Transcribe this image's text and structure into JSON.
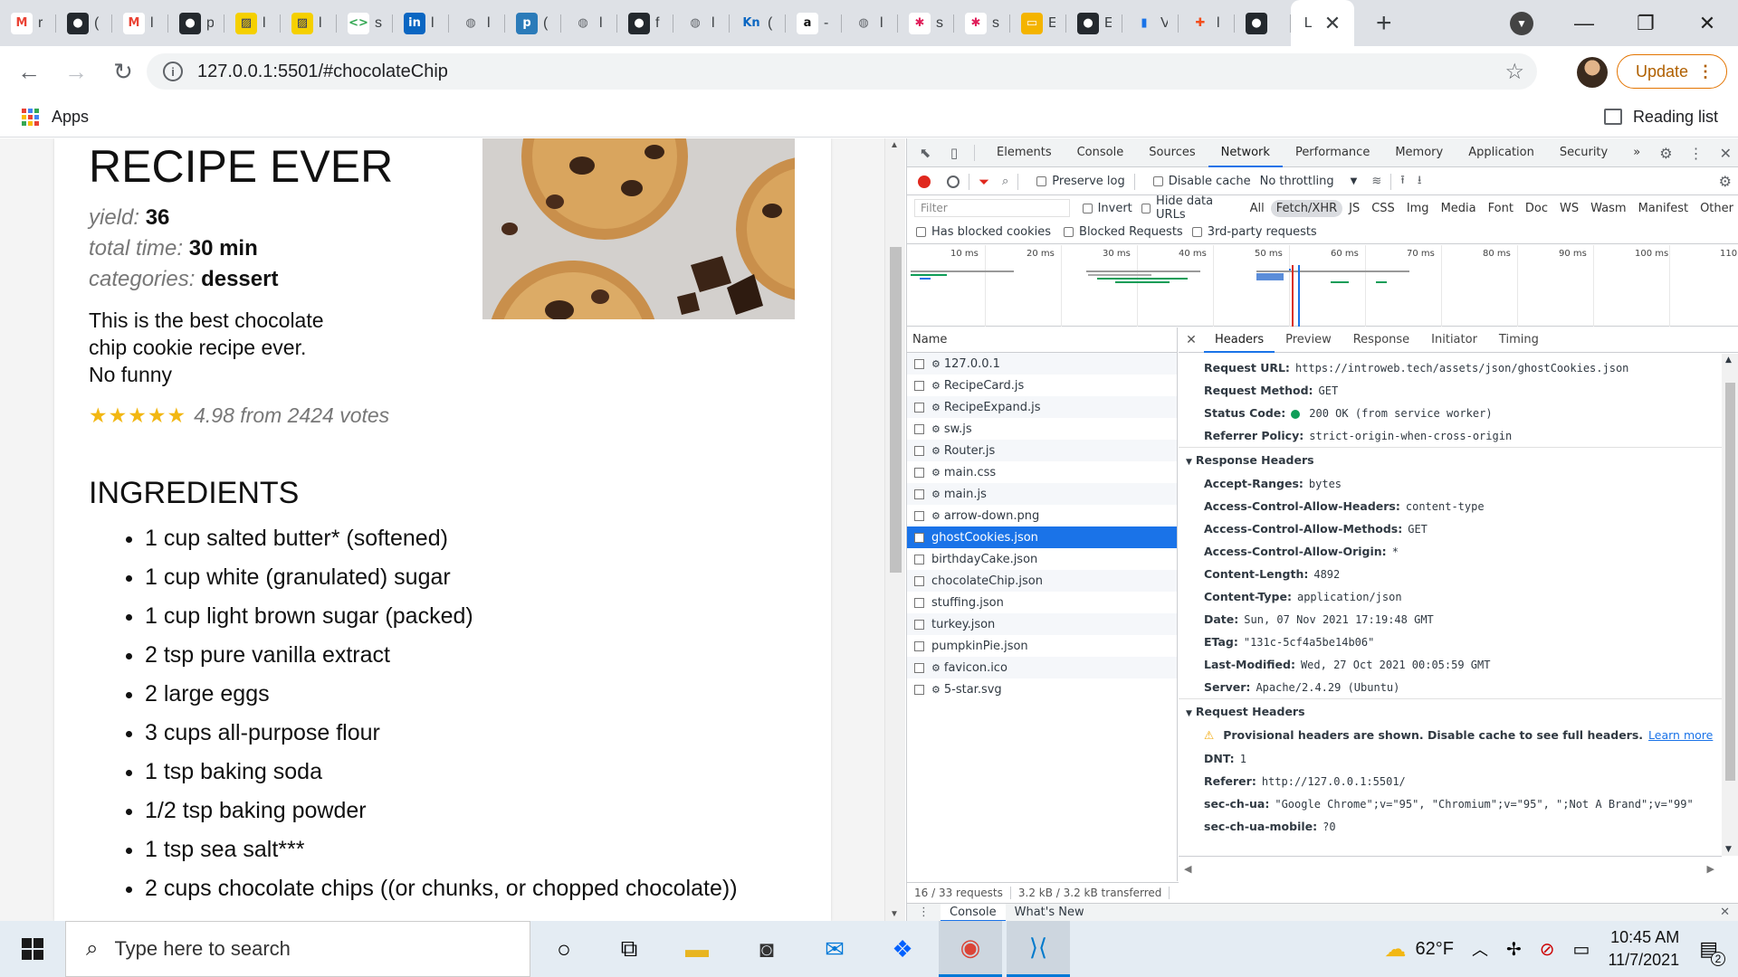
{
  "browser": {
    "tabs": [
      {
        "icon": "gmail-icon",
        "char": "r",
        "color": "#ffffff"
      },
      {
        "icon": "github-icon",
        "char": "(",
        "color": "#ffffff"
      },
      {
        "icon": "gmail-icon",
        "char": "l",
        "color": "#ffffff"
      },
      {
        "icon": "github-icon",
        "char": "p",
        "color": "#ffffff"
      },
      {
        "icon": "stripes-icon",
        "char": "l",
        "color": "#1e2a6e"
      },
      {
        "icon": "stripes-icon",
        "char": "l",
        "color": "#1e2a6e"
      },
      {
        "icon": "code-icon",
        "char": "s",
        "color": "#ffffff"
      },
      {
        "icon": "linkedin-icon",
        "char": "l",
        "color": "#0a66c2"
      },
      {
        "icon": "globe-icon",
        "char": "l",
        "color": "#5f6368"
      },
      {
        "icon": "p-icon",
        "char": "(",
        "color": "#2b7bb9"
      },
      {
        "icon": "globe-icon",
        "char": "l",
        "color": "#5f6368"
      },
      {
        "icon": "github-icon",
        "char": "f",
        "color": "#ffffff"
      },
      {
        "icon": "globe-icon",
        "char": "l",
        "color": "#5f6368"
      },
      {
        "icon": "kn-icon",
        "char": "(",
        "color": "#ffffff"
      },
      {
        "icon": "amazon-icon",
        "char": "-",
        "color": "#ffffff"
      },
      {
        "icon": "globe-icon",
        "char": "l",
        "color": "#5f6368"
      },
      {
        "icon": "slack-icon",
        "char": "s",
        "color": "#ffffff"
      },
      {
        "icon": "slack-icon",
        "char": "s",
        "color": "#ffffff"
      },
      {
        "icon": "slides-icon",
        "char": "E",
        "color": "#f4b400"
      },
      {
        "icon": "github-icon",
        "char": "E",
        "color": "#ffffff"
      },
      {
        "icon": "chart-icon",
        "char": "V",
        "color": "#ffffff"
      },
      {
        "icon": "figma-icon",
        "char": "l",
        "color": "#ffffff"
      },
      {
        "icon": "github-icon",
        "char": "",
        "color": "#ffffff"
      }
    ],
    "active_tab_char": "L",
    "url": "127.0.0.1:5501/#chocolateChip",
    "update_label": "Update",
    "apps_label": "Apps",
    "reading_list_label": "Reading list"
  },
  "recipe": {
    "title": "RECIPE EVER",
    "yield_label": "yield:",
    "yield_value": "36",
    "time_label": "total time:",
    "time_value": "30 min",
    "categories_label": "categories:",
    "categories_value": "dessert",
    "description": "This is the best chocolate chip cookie recipe ever. No funny",
    "stars": "★★★★★",
    "rating_text": "4.98 from 2424 votes",
    "ingredients_heading": "INGREDIENTS",
    "ingredients": [
      "1 cup salted butter* (softened)",
      "1 cup white (granulated) sugar",
      "1 cup light brown sugar (packed)",
      "2 tsp pure vanilla extract",
      "2 large eggs",
      "3 cups all-purpose flour",
      "1 tsp baking soda",
      "1/2 tsp baking powder",
      "1 tsp sea salt***",
      "2 cups chocolate chips ((or chunks, or chopped chocolate))"
    ]
  },
  "devtools": {
    "tabs": [
      "Elements",
      "Console",
      "Sources",
      "Network",
      "Performance",
      "Memory",
      "Application",
      "Security"
    ],
    "active_tab": "Network",
    "more": "»",
    "preserve_log": "Preserve log",
    "disable_cache": "Disable cache",
    "throttling": "No throttling",
    "filter_placeholder": "Filter",
    "invert": "Invert",
    "hide_data_urls": "Hide data URLs",
    "type_filters": [
      "All",
      "Fetch/XHR",
      "JS",
      "CSS",
      "Img",
      "Media",
      "Font",
      "Doc",
      "WS",
      "Wasm",
      "Manifest",
      "Other"
    ],
    "selected_type": "Fetch/XHR",
    "has_blocked_cookies": "Has blocked cookies",
    "blocked_requests": "Blocked Requests",
    "third_party": "3rd-party requests",
    "timeline_ticks": [
      "10 ms",
      "20 ms",
      "30 ms",
      "40 ms",
      "50 ms",
      "60 ms",
      "70 ms",
      "80 ms",
      "90 ms",
      "100 ms",
      "110"
    ],
    "name_header": "Name",
    "requests": [
      {
        "name": "127.0.0.1",
        "gear": true
      },
      {
        "name": "RecipeCard.js",
        "gear": true
      },
      {
        "name": "RecipeExpand.js",
        "gear": true
      },
      {
        "name": "sw.js",
        "gear": true
      },
      {
        "name": "Router.js",
        "gear": true
      },
      {
        "name": "main.css",
        "gear": true
      },
      {
        "name": "main.js",
        "gear": true
      },
      {
        "name": "arrow-down.png",
        "gear": true
      },
      {
        "name": "ghostCookies.json",
        "gear": false,
        "selected": true
      },
      {
        "name": "birthdayCake.json",
        "gear": false
      },
      {
        "name": "chocolateChip.json",
        "gear": false
      },
      {
        "name": "stuffing.json",
        "gear": false
      },
      {
        "name": "turkey.json",
        "gear": false
      },
      {
        "name": "pumpkinPie.json",
        "gear": false
      },
      {
        "name": "favicon.ico",
        "gear": true
      },
      {
        "name": "5-star.svg",
        "gear": true
      }
    ],
    "detail_tabs": [
      "Headers",
      "Preview",
      "Response",
      "Initiator",
      "Timing"
    ],
    "active_detail_tab": "Headers",
    "general": [
      {
        "k": "Request URL:",
        "v": "https://introweb.tech/assets/json/ghostCookies.json"
      },
      {
        "k": "Request Method:",
        "v": "GET"
      },
      {
        "k": "Status Code:",
        "v": "200 OK (from service worker)",
        "status": true
      },
      {
        "k": "Referrer Policy:",
        "v": "strict-origin-when-cross-origin"
      }
    ],
    "response_headers_title": "Response Headers",
    "response_headers": [
      {
        "k": "Accept-Ranges:",
        "v": "bytes"
      },
      {
        "k": "Access-Control-Allow-Headers:",
        "v": "content-type"
      },
      {
        "k": "Access-Control-Allow-Methods:",
        "v": "GET"
      },
      {
        "k": "Access-Control-Allow-Origin:",
        "v": "*"
      },
      {
        "k": "Content-Length:",
        "v": "4892"
      },
      {
        "k": "Content-Type:",
        "v": "application/json"
      },
      {
        "k": "Date:",
        "v": "Sun, 07 Nov 2021 17:19:48 GMT"
      },
      {
        "k": "ETag:",
        "v": "\"131c-5cf4a5be14b06\""
      },
      {
        "k": "Last-Modified:",
        "v": "Wed, 27 Oct 2021 00:05:59 GMT"
      },
      {
        "k": "Server:",
        "v": "Apache/2.4.29 (Ubuntu)"
      }
    ],
    "request_headers_title": "Request Headers",
    "provisional_warning": "Provisional headers are shown. Disable cache to see full headers.",
    "learn_more": "Learn more",
    "request_headers": [
      {
        "k": "DNT:",
        "v": "1"
      },
      {
        "k": "Referer:",
        "v": "http://127.0.0.1:5501/"
      },
      {
        "k": "sec-ch-ua:",
        "v": "\"Google Chrome\";v=\"95\", \"Chromium\";v=\"95\", \";Not A Brand\";v=\"99\""
      },
      {
        "k": "sec-ch-ua-mobile:",
        "v": "?0"
      }
    ],
    "status_requests": "16 / 33 requests",
    "status_transferred": "3.2 kB / 3.2 kB transferred",
    "drawer_tabs": [
      "Console",
      "What's New"
    ]
  },
  "taskbar": {
    "search_placeholder": "Type here to search",
    "temperature": "62°F",
    "time": "10:45 AM",
    "date": "11/7/2021",
    "notifications": "2"
  },
  "colors": {
    "accent": "#1a73e8",
    "star": "#f2b713",
    "record": "#e0281e",
    "status_ok": "#0f9d58"
  }
}
